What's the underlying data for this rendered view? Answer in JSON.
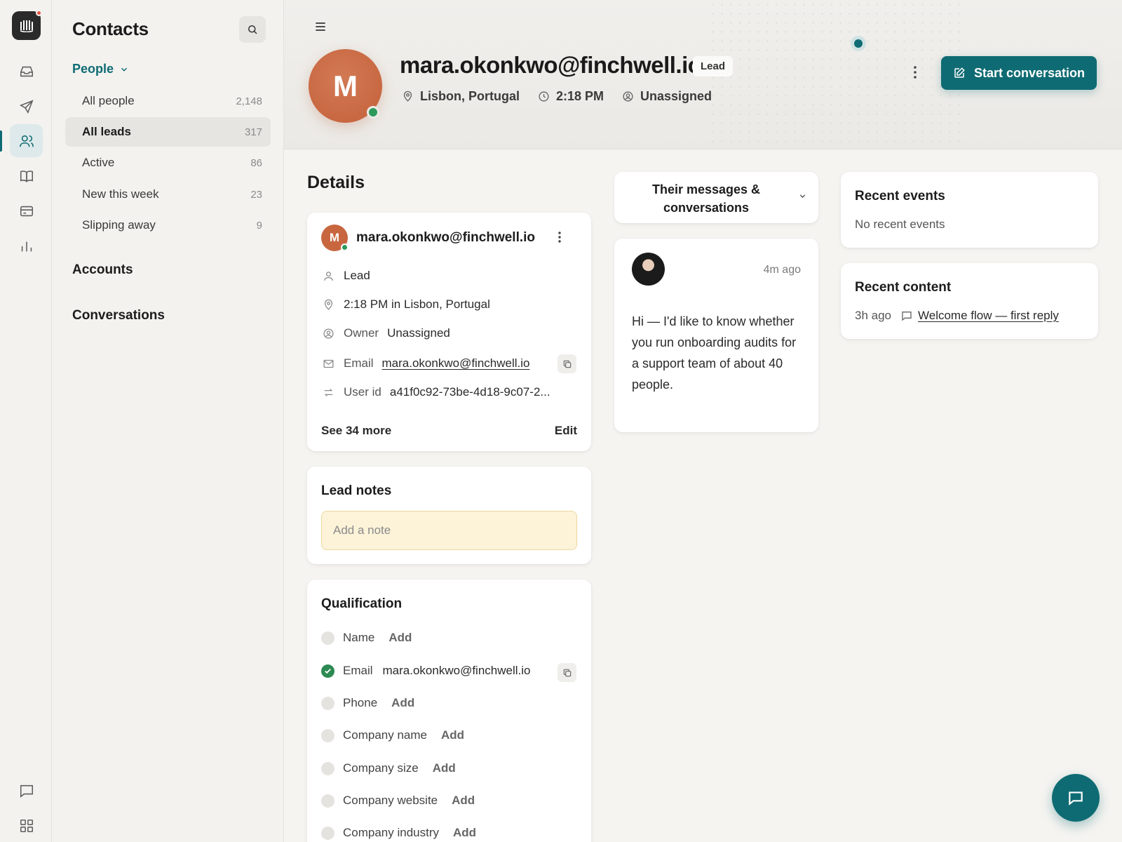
{
  "sidebar": {
    "title": "Contacts",
    "people_label": "People",
    "items": [
      {
        "label": "All people",
        "count": "2,148"
      },
      {
        "label": "All leads",
        "count": "317"
      },
      {
        "label": "Active",
        "count": "86"
      },
      {
        "label": "New this week",
        "count": "23"
      },
      {
        "label": "Slipping away",
        "count": "9"
      }
    ],
    "accounts": "Accounts",
    "conversations": "Conversations"
  },
  "header": {
    "avatar_initial": "M",
    "email": "mara.okonkwo@finchwell.io",
    "badge": "Lead",
    "location": "Lisbon, Portugal",
    "time": "2:18 PM",
    "owner": "Unassigned",
    "start_button": "Start conversation"
  },
  "details": {
    "title": "Details",
    "card": {
      "avatar_initial": "M",
      "email": "mara.okonkwo@finchwell.io",
      "type": "Lead",
      "local_time": "2:18 PM in Lisbon, Portugal",
      "owner_label": "Owner",
      "owner_value": "Unassigned",
      "email_label": "Email",
      "email_value": "mara.okonkwo@finchwell.io",
      "user_id_label": "User id",
      "user_id_value": "a41f0c92-73be-4d18-9c07-2...",
      "see_more": "See 34 more",
      "edit": "Edit"
    },
    "lead_notes": {
      "title": "Lead notes",
      "placeholder": "Add a note"
    },
    "qualification": {
      "title": "Qualification",
      "add_label": "Add",
      "items": [
        {
          "label": "Name",
          "value": "Add"
        },
        {
          "label": "Email",
          "value": "mara.okonkwo@finchwell.io"
        },
        {
          "label": "Phone",
          "value": "Add"
        },
        {
          "label": "Company name",
          "value": "Add"
        },
        {
          "label": "Company size",
          "value": "Add"
        },
        {
          "label": "Company website",
          "value": "Add"
        },
        {
          "label": "Company industry",
          "value": "Add"
        }
      ]
    }
  },
  "messages": {
    "dropdown_line1": "Their messages &",
    "dropdown_line2": "conversations",
    "time_ago": "4m ago",
    "body": "Hi — I'd like to know whether you run onboarding audits for a support team of about 40 people."
  },
  "recent_events": {
    "title": "Recent events",
    "empty": "No recent events"
  },
  "recent_content": {
    "title": "Recent content",
    "time_ago": "3h ago",
    "link": "Welcome flow — first reply"
  },
  "colors": {
    "accent": "#0f6b73",
    "avatar": "#c8663f",
    "online": "#2d9a5c",
    "note_bg": "#fcf3d9"
  }
}
